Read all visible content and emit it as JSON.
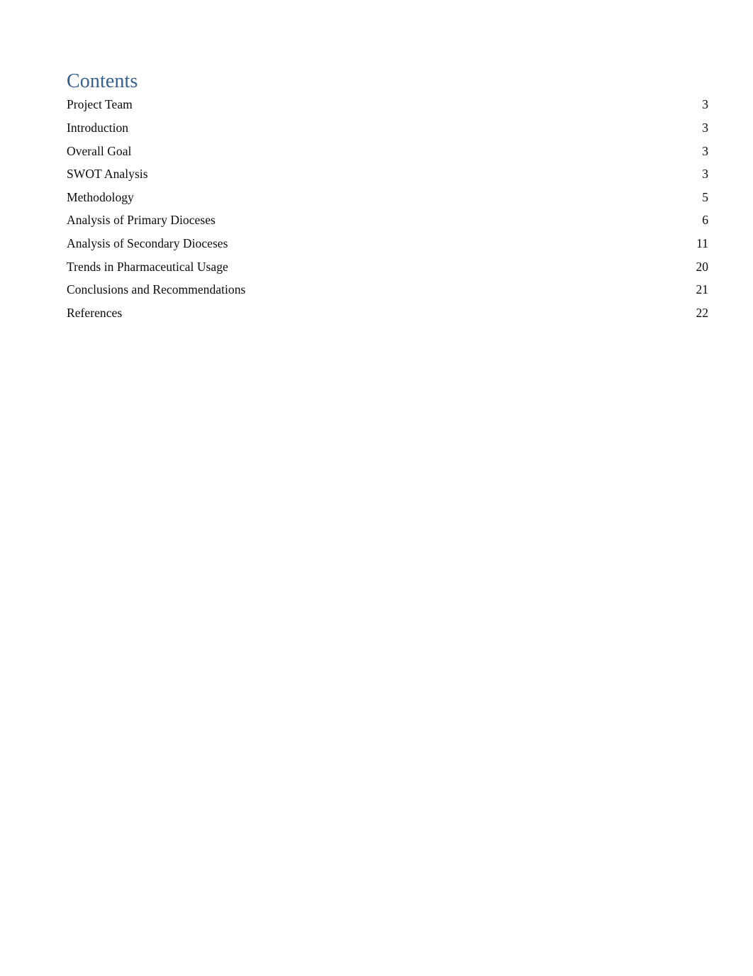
{
  "document": {
    "page_background": "#ffffff",
    "heading_color": "#365f91",
    "body_text_color": "#0a0a0a"
  },
  "toc": {
    "heading": "Contents",
    "entries": [
      {
        "title": "Project Team",
        "page": "3"
      },
      {
        "title": "Introduction",
        "page": "3"
      },
      {
        "title": "Overall Goal",
        "page": "3"
      },
      {
        "title": "SWOT Analysis",
        "page": "3"
      },
      {
        "title": "Methodology",
        "page": "5"
      },
      {
        "title": "Analysis of Primary Dioceses",
        "page": "6"
      },
      {
        "title": "Analysis of Secondary Dioceses",
        "page": "11"
      },
      {
        "title": "Trends in Pharmaceutical Usage",
        "page": "20"
      },
      {
        "title": "Conclusions and Recommendations",
        "page": "21"
      },
      {
        "title": "References",
        "page": "22"
      }
    ]
  }
}
